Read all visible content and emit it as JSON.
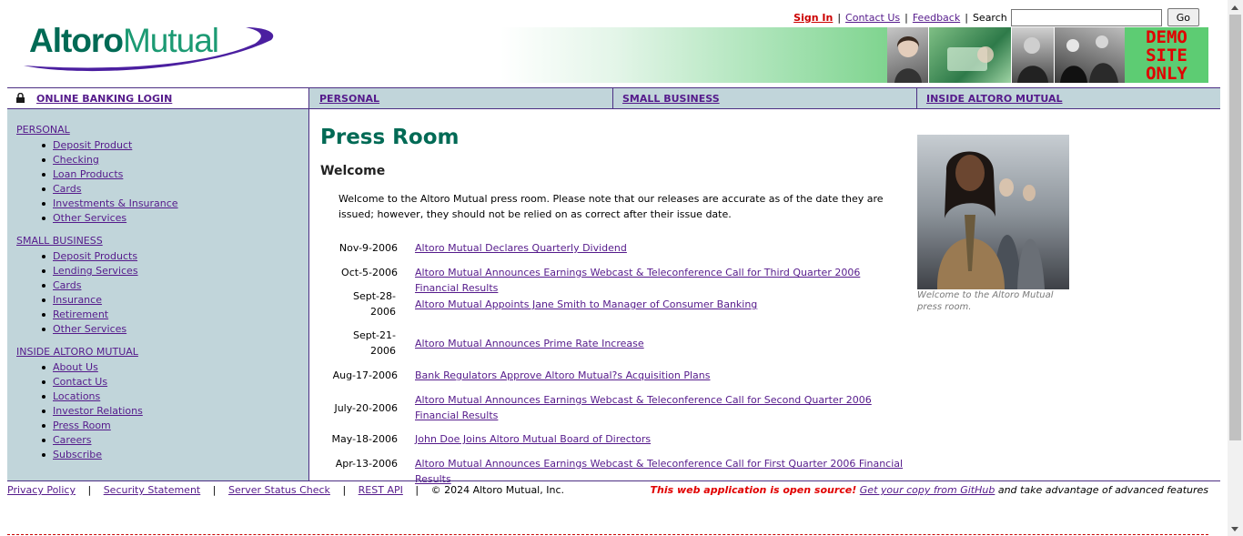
{
  "header": {
    "logo_part1": "Altoro",
    "logo_part2": "Mutual",
    "top_links": {
      "sign_in": "Sign In",
      "contact_us": "Contact Us",
      "feedback": "Feedback"
    },
    "search": {
      "label": "Search",
      "value": "",
      "placeholder": ""
    },
    "go_label": "Go",
    "demo_badge": [
      "DEMO",
      "SITE",
      "ONLY"
    ]
  },
  "nav": {
    "login": "ONLINE BANKING LOGIN",
    "personal": "PERSONAL",
    "small_business": "SMALL BUSINESS",
    "inside": "INSIDE ALTORO MUTUAL"
  },
  "sidebar": {
    "sections": [
      {
        "title": "PERSONAL",
        "items": [
          "Deposit Product",
          "Checking",
          "Loan Products",
          "Cards",
          "Investments & Insurance",
          "Other Services"
        ]
      },
      {
        "title": "SMALL BUSINESS",
        "items": [
          "Deposit Products",
          "Lending Services",
          "Cards",
          "Insurance",
          "Retirement",
          "Other Services"
        ]
      },
      {
        "title": "INSIDE ALTORO MUTUAL",
        "items": [
          "About Us",
          "Contact Us",
          "Locations",
          "Investor Relations",
          "Press Room",
          "Careers",
          "Subscribe"
        ]
      }
    ]
  },
  "content": {
    "title": "Press Room",
    "subtitle": "Welcome",
    "intro": "Welcome to the Altoro Mutual press room. Please note that our releases are accurate as of the date they are issued; however, they should not be relied on as correct after their issue date.",
    "releases": [
      {
        "date": "Nov-9-2006",
        "title": "Altoro Mutual Declares Quarterly Dividend"
      },
      {
        "date": "Oct-5-2006",
        "title": "Altoro Mutual Announces Earnings Webcast & Teleconference Call for Third Quarter 2006 Financial Results"
      },
      {
        "date": "Sept-28-2006",
        "title": "Altoro Mutual Appoints Jane Smith to Manager of Consumer Banking"
      },
      {
        "date": "Sept-21-2006",
        "title": "Altoro Mutual Announces Prime Rate Increase"
      },
      {
        "date": "Aug-17-2006",
        "title": "Bank Regulators Approve Altoro Mutual?s Acquisition Plans"
      },
      {
        "date": "July-20-2006",
        "title": "Altoro Mutual Announces Earnings Webcast & Teleconference Call for Second Quarter 2006 Financial Results"
      },
      {
        "date": "May-18-2006",
        "title": "John Doe Joins Altoro Mutual Board of Directors"
      },
      {
        "date": "Apr-13-2006",
        "title": "Altoro Mutual Announces Earnings Webcast & Teleconference Call for First Quarter 2006 Financial Results"
      }
    ],
    "photo_caption": "Welcome to the Altoro Mutual press room."
  },
  "footer": {
    "links": [
      "Privacy Policy",
      "Security Statement",
      "Server Status Check",
      "REST API"
    ],
    "copyright": "© 2024 Altoro Mutual, Inc.",
    "opensource_note": "This web application is open source!",
    "github_link": "Get your copy from GitHub",
    "trailing_text": "and take advantage of advanced features"
  }
}
